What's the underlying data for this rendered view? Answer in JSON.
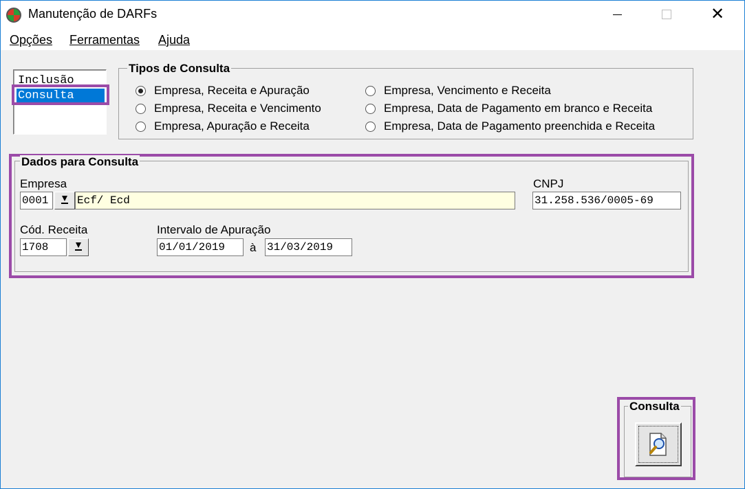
{
  "window": {
    "title": "Manutenção de DARFs"
  },
  "menu": [
    {
      "label": "Opções"
    },
    {
      "label": "Ferramentas"
    },
    {
      "label": "Ajuda"
    }
  ],
  "mode_list": {
    "items": [
      "Inclusão",
      "Consulta"
    ],
    "selected": "Consulta"
  },
  "query_types": {
    "title": "Tipos de Consulta",
    "options": [
      "Empresa, Receita e Apuração",
      "Empresa, Receita e Vencimento",
      "Empresa, Apuração e Receita",
      "Empresa, Vencimento e Receita",
      "Empresa, Data de Pagamento em branco e Receita",
      "Empresa, Data de Pagamento preenchida e Receita"
    ],
    "selected_index": 0
  },
  "query_data": {
    "title": "Dados para Consulta",
    "empresa_label": "Empresa",
    "empresa_code": "0001",
    "empresa_name": "Ecf/ Ecd",
    "cnpj_label": "CNPJ",
    "cnpj": "31.258.536/0005-69",
    "receita_label": "Cód. Receita",
    "receita_code": "1708",
    "interval_label": "Intervalo de Apuração",
    "date_from": "01/01/2019",
    "date_sep": "à",
    "date_to": "31/03/2019"
  },
  "action": {
    "title": "Consulta",
    "icon": "magnifier-document-icon"
  },
  "colors": {
    "highlight": "#9b4ba8",
    "selection": "#0078d7",
    "input_yellow": "#ffffe1"
  }
}
